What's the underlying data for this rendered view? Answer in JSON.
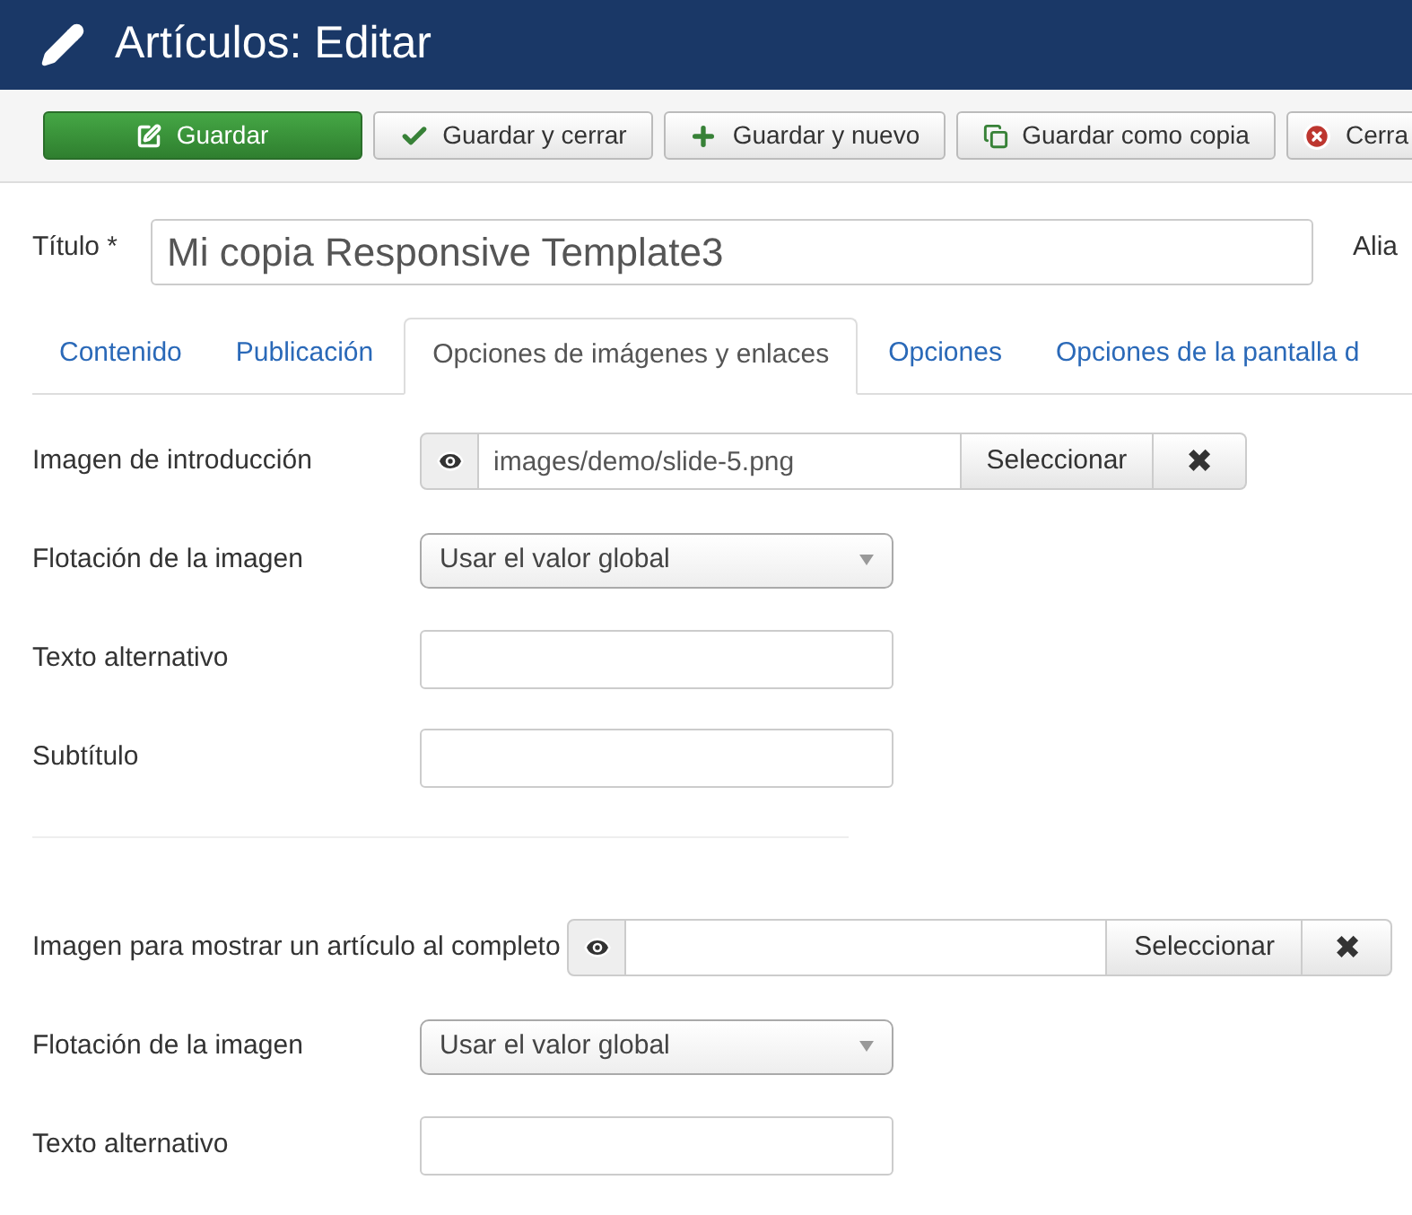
{
  "header": {
    "title": "Artículos: Editar"
  },
  "toolbar": [
    {
      "kind": "save",
      "label": "Guardar"
    },
    {
      "kind": "check",
      "label": "Guardar y cerrar"
    },
    {
      "kind": "plus",
      "label": "Guardar y nuevo"
    },
    {
      "kind": "copy",
      "label": "Guardar como copia"
    },
    {
      "kind": "close",
      "label": "Cerra"
    }
  ],
  "title_field": {
    "label": "Título *",
    "value": "Mi copia Responsive Template3"
  },
  "alias_label": "Alia",
  "tabs": [
    {
      "label": "Contenido",
      "selected": false
    },
    {
      "label": "Publicación",
      "selected": false
    },
    {
      "label": "Opciones de imágenes y enlaces",
      "selected": true
    },
    {
      "label": "Opciones",
      "selected": false
    },
    {
      "label": "Opciones de la pantalla d",
      "selected": false
    }
  ],
  "sections": [
    {
      "fields": [
        {
          "kind": "media",
          "label": "Imagen de introducción",
          "value": "images/demo/slide-5.png",
          "button": "Seleccionar",
          "clear": "✖"
        },
        {
          "kind": "select",
          "label": "Flotación de la imagen",
          "value": "Usar el valor global"
        },
        {
          "kind": "text",
          "label": "Texto alternativo"
        },
        {
          "kind": "text",
          "label": "Subtítulo"
        }
      ]
    },
    {
      "fields": [
        {
          "kind": "media",
          "label": "Imagen para mostrar un artículo al completo",
          "button": "Seleccionar",
          "clear": "✖"
        },
        {
          "kind": "select",
          "label": "Flotación de la imagen",
          "value": "Usar el valor global"
        },
        {
          "kind": "text",
          "label": "Texto alternativo"
        }
      ]
    }
  ]
}
